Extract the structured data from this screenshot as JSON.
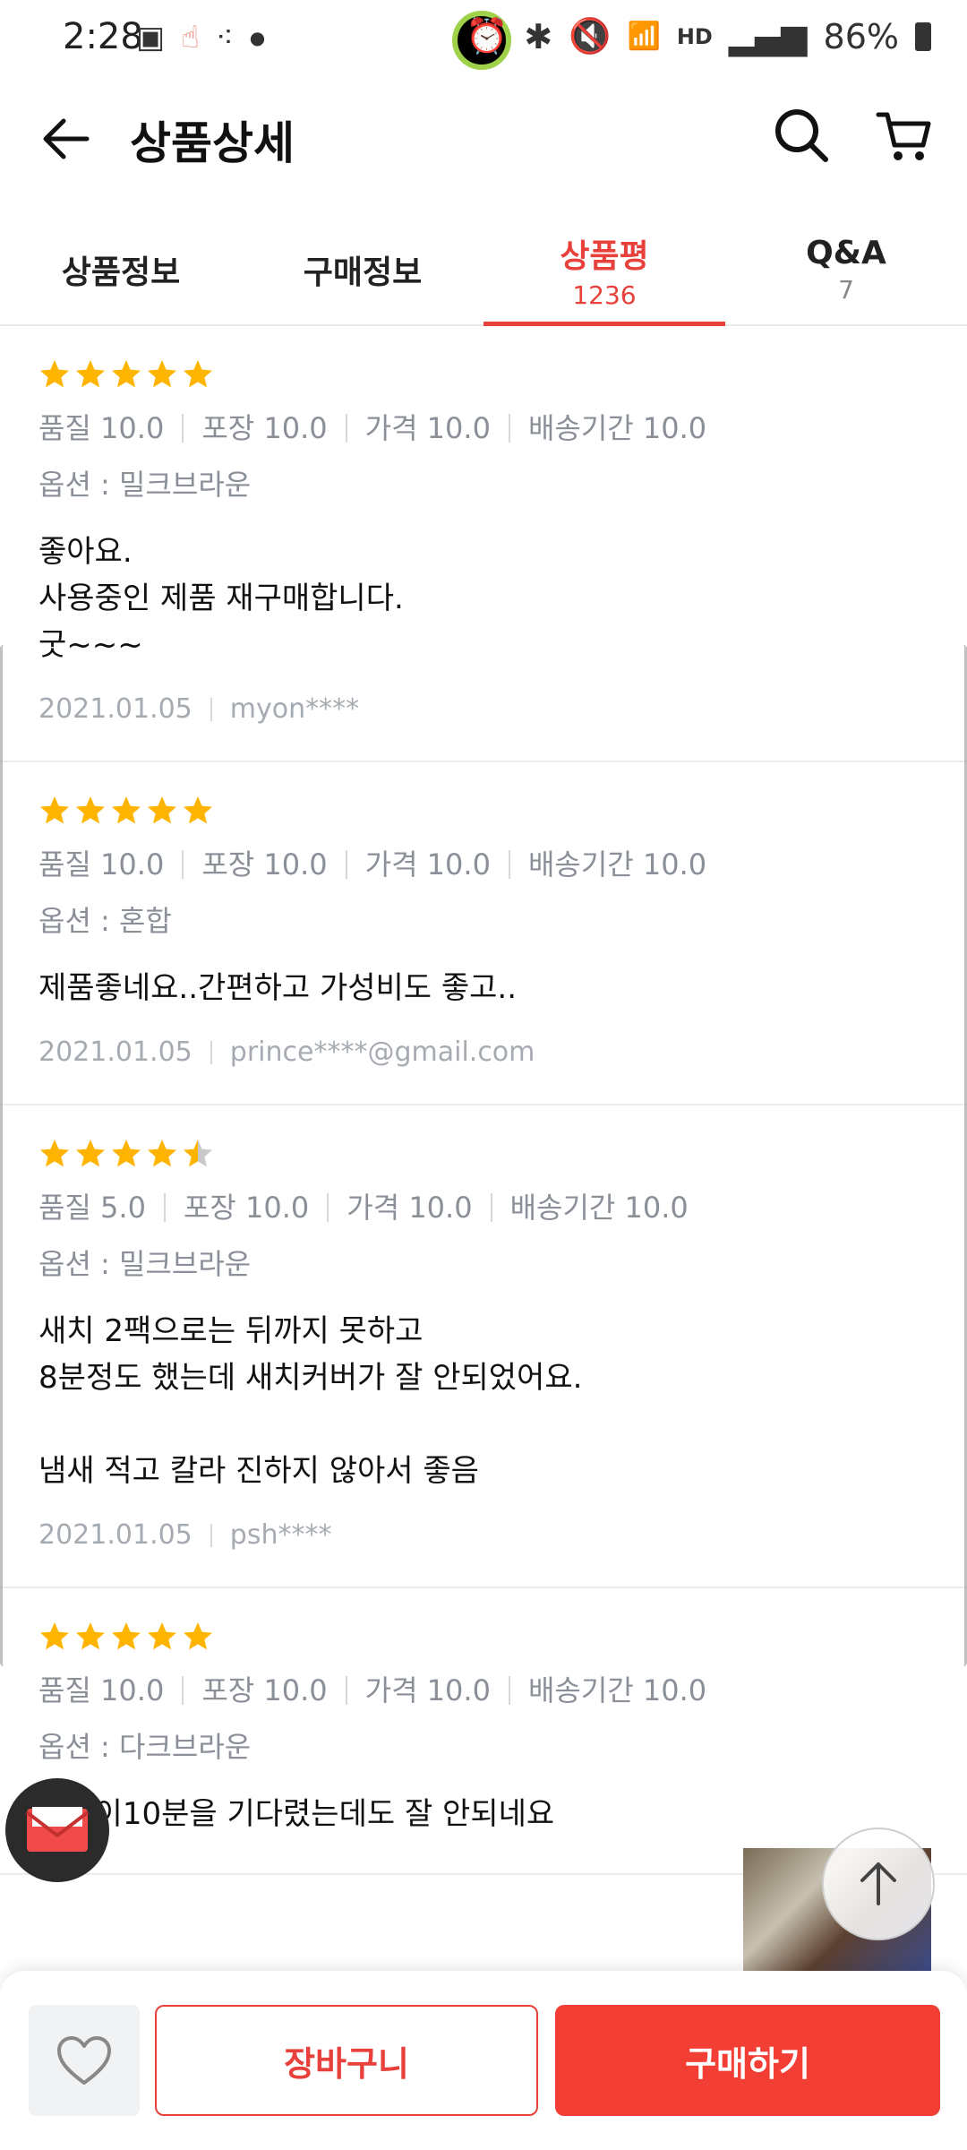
{
  "status_bar": {
    "time": "2:28",
    "battery": "86%",
    "network_label": "HD"
  },
  "header": {
    "title": "상품상세"
  },
  "tabs": [
    {
      "label": "상품정보",
      "count": ""
    },
    {
      "label": "구매정보",
      "count": ""
    },
    {
      "label": "상품평",
      "count": "1236"
    },
    {
      "label": "Q&A",
      "count": "7"
    }
  ],
  "reviews": [
    {
      "rating": 5,
      "scores": [
        "품질 10.0",
        "포장 10.0",
        "가격 10.0",
        "배송기간 10.0"
      ],
      "option": "옵션 : 밀크브라운",
      "text": "좋아요.\n사용중인 제품 재구매합니다.\n굿~~~",
      "date": "2021.01.05",
      "user": "myon****"
    },
    {
      "rating": 5,
      "scores": [
        "품질 10.0",
        "포장 10.0",
        "가격 10.0",
        "배송기간 10.0"
      ],
      "option": "옵션 : 혼합",
      "text": "제품좋네요..간편하고 가성비도 좋고..",
      "date": "2021.01.05",
      "user": "prince****@gmail.com"
    },
    {
      "rating": 4.5,
      "scores": [
        "품질 5.0",
        "포장 10.0",
        "가격 10.0",
        "배송기간 10.0"
      ],
      "option": "옵션 : 밀크브라운",
      "text": "새치 2팩으로는 뒤까지 못하고\n8분정도 했는데 새치커버가 잘 안되었어요.\n\n냄새 적고 칼라 진하지 않아서 좋음",
      "date": "2021.01.05",
      "user": "psh****"
    },
    {
      "rating": 5,
      "scores": [
        "품질 10.0",
        "포장 10.0",
        "가격 10.0",
        "배송기간 10.0"
      ],
      "option": "옵션 : 다크브라운",
      "text": "검색이10분을 기다렸는데도 잘 안되네요",
      "date": "",
      "user": ""
    }
  ],
  "bottom_bar": {
    "cart_label": "장바구니",
    "buy_label": "구매하기"
  },
  "colors": {
    "accent": "#e8413c",
    "star": "#ffb400",
    "star_empty": "#c8c8c8"
  }
}
